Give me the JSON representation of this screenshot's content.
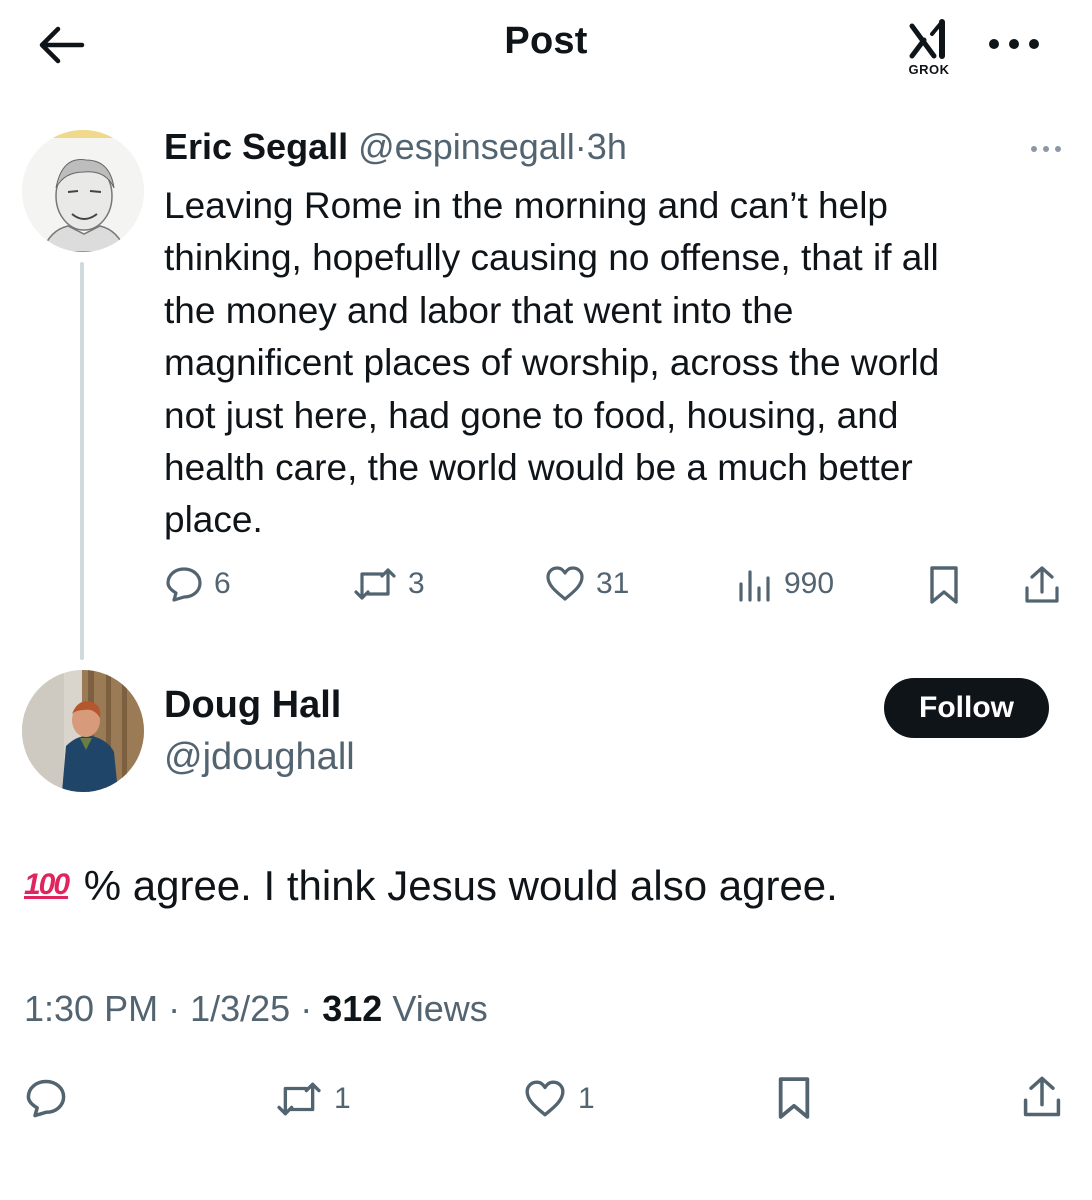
{
  "header": {
    "title": "Post",
    "grok_label": "GROK"
  },
  "parent_post": {
    "author_name": "Eric Segall",
    "handle": "@espinsegall",
    "separator": "·",
    "time": "3h",
    "text": "Leaving Rome in the morning and can’t help thinking, hopefully causing no offense, that if all the money and labor that went into the magnificent places of worship, across the world not just here, had gone to food, housing, and health care, the world would be a much better place.",
    "text_lines": [
      "Leaving Rome in the morning and can’t help",
      "thinking, hopefully causing no offense, that if all",
      "the money and labor that went into the",
      "magnificent places of worship, across the world",
      "not just here, had gone to food, housing, and",
      "health care, the world would be a much better",
      "place."
    ],
    "stats": {
      "replies": "6",
      "reposts": "3",
      "likes": "31",
      "views": "990"
    }
  },
  "reply_post": {
    "author_name": "Doug Hall",
    "handle": "@jdoughall",
    "follow_label": "Follow",
    "emoji_text": "100",
    "text": "% agree. I think Jesus would also agree.",
    "time": "1:30 PM",
    "date": "1/3/25",
    "separator": "·",
    "views_count": "312",
    "views_label": "Views",
    "stats": {
      "reposts": "1",
      "likes": "1"
    }
  },
  "icons": [
    "back-arrow-icon",
    "grok-icon",
    "more-icon",
    "reply-icon",
    "repost-icon",
    "like-icon",
    "views-icon",
    "bookmark-icon",
    "share-icon"
  ],
  "colors": {
    "text_primary": "#0f1419",
    "text_secondary": "#536471",
    "follow_bg": "#0f1419",
    "hundred_red": "#e0245e",
    "thread_line": "#cfd9de"
  }
}
